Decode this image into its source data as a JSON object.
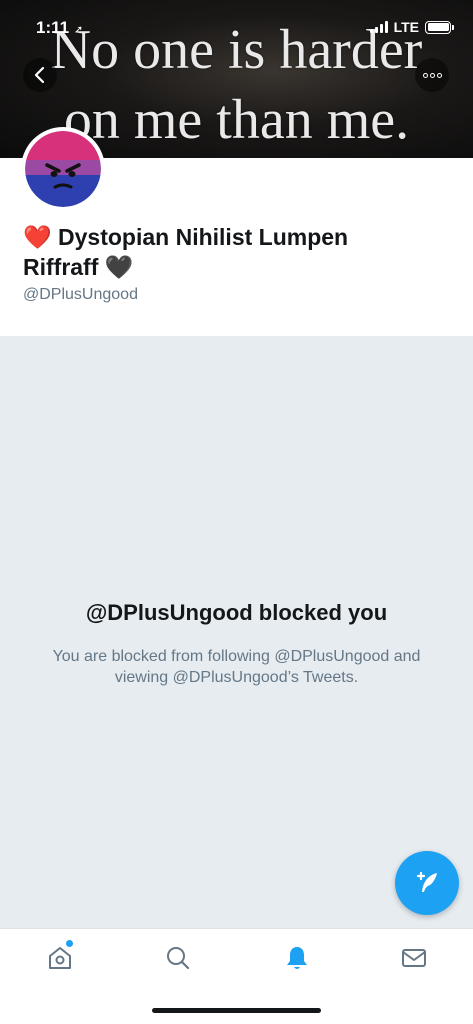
{
  "status_bar": {
    "time": "1:11",
    "network": "LTE"
  },
  "banner": {
    "line1": "No one is harder",
    "line2": "on me than me."
  },
  "profile": {
    "name_line1": "Dystopian Nihilist Lumpen",
    "name_line2": "Riffraff",
    "heart_left": "❤️",
    "heart_right": "🖤",
    "handle": "@DPlusUngood"
  },
  "blocked": {
    "title": "@DPlusUngood blocked you",
    "message": "You are blocked from following @DPlusUngood and viewing @DPlusUngood’s Tweets."
  },
  "colors": {
    "accent": "#1da1f2",
    "blocked_bg": "#e6ecf0",
    "secondary_text": "#657786"
  },
  "tabs": [
    {
      "icon": "home-icon",
      "active": false,
      "badge": true
    },
    {
      "icon": "search-icon",
      "active": false
    },
    {
      "icon": "bell-icon",
      "active": true
    },
    {
      "icon": "mail-icon",
      "active": false
    }
  ]
}
